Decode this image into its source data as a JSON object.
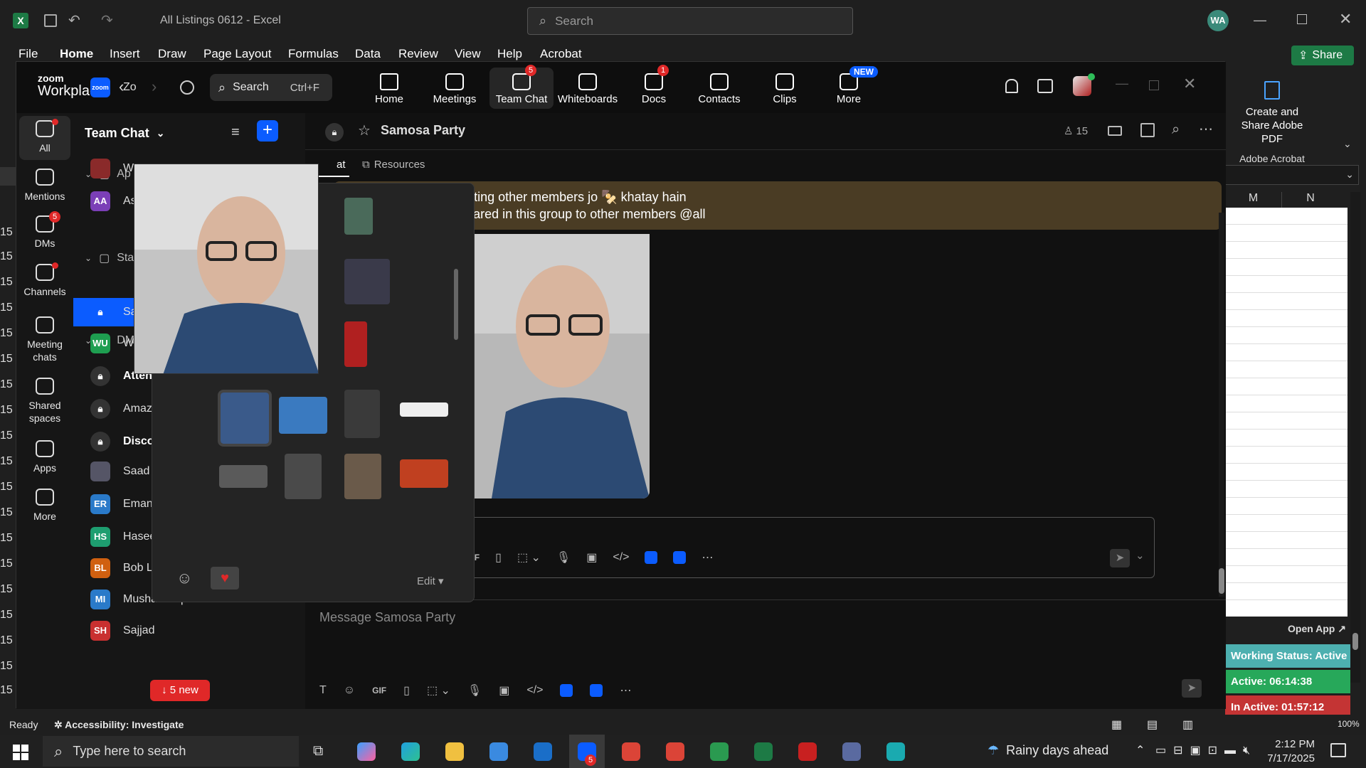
{
  "excel": {
    "title": "All Listings 0612  -  Excel",
    "search_placeholder": "Search",
    "user_initials": "WA",
    "share": "Share",
    "tabs": [
      "File",
      "Home",
      "Insert",
      "Draw",
      "Page Layout",
      "Formulas",
      "Data",
      "Review",
      "View",
      "Help",
      "Acrobat"
    ],
    "adobe_create": "Create and Share Adobe PDF",
    "adobe_group": "Adobe Acrobat",
    "col_m": "M",
    "col_n": "N",
    "row_number": "15",
    "status_ready": "Ready",
    "accessibility": "Accessibility: Investigate",
    "zoom_pct": "100%",
    "open_app": "Open App ↗"
  },
  "zoom": {
    "brand_top": "zoom",
    "brand_bottom": "Workplace",
    "search_label": "Search",
    "search_shortcut": "Ctrl+F",
    "nav": [
      {
        "label": "Home",
        "icon": "home-icon",
        "badge": ""
      },
      {
        "label": "Meetings",
        "icon": "video-icon",
        "badge": ""
      },
      {
        "label": "Team Chat",
        "icon": "chat-icon",
        "badge": "5"
      },
      {
        "label": "Whiteboards",
        "icon": "whiteboard-icon",
        "badge": ""
      },
      {
        "label": "Docs",
        "icon": "docs-icon",
        "badge": "1"
      },
      {
        "label": "Contacts",
        "icon": "contacts-icon",
        "badge": ""
      },
      {
        "label": "Clips",
        "icon": "clips-icon",
        "badge": ""
      },
      {
        "label": "More",
        "icon": "more-icon",
        "badge": "NEW"
      }
    ],
    "rail": [
      {
        "label": "All",
        "icon": "chat-bubble-icon",
        "badge": ""
      },
      {
        "label": "Mentions",
        "icon": "at-icon",
        "badge": ""
      },
      {
        "label": "DMs",
        "icon": "people-icon",
        "badge": "5"
      },
      {
        "label": "Channels",
        "icon": "hash-icon",
        "badge": ""
      },
      {
        "label": "Meeting chats",
        "icon": "calendar-icon",
        "badge": ""
      },
      {
        "label": "Shared spaces",
        "icon": "share-icon",
        "badge": ""
      },
      {
        "label": "Apps",
        "icon": "apps-icon",
        "badge": ""
      },
      {
        "label": "More",
        "icon": "more-dots-icon",
        "badge": ""
      }
    ],
    "chatlist": {
      "title": "Team Chat",
      "sections": [
        {
          "label": "Ap"
        },
        {
          "label": "Sta"
        },
        {
          "label": "DM"
        }
      ],
      "items": [
        {
          "label": "Zo",
          "avatar": "zoom",
          "color": "#0b5cff"
        },
        {
          "label": "W",
          "avatar": "",
          "color": "#8a2a2a"
        },
        {
          "label": "As",
          "avatar": "AA",
          "color": "#7b3fb7"
        },
        {
          "label": "Samosa Party",
          "avatar": "lock",
          "color": "#0b5cff"
        },
        {
          "label": "Waleed Ur Re",
          "avatar": "WU",
          "color": "#1e9e50"
        },
        {
          "label": "Attendance",
          "avatar": "lock",
          "color": "#333"
        },
        {
          "label": "Amazon Sales",
          "avatar": "lock",
          "color": "#333"
        },
        {
          "label": "Discount & S",
          "avatar": "lock",
          "color": "#333"
        },
        {
          "label": "Saad Hassan",
          "avatar": "",
          "color": "#556"
        },
        {
          "label": "Eman Rauf",
          "avatar": "ER",
          "color": "#2a7ac9"
        },
        {
          "label": "Haseeb Shahzad",
          "avatar": "HS",
          "color": "#1e9e70"
        },
        {
          "label": "Bob Lyon",
          "avatar": "BL",
          "color": "#d06010"
        },
        {
          "label": "Musharaf Iqbal",
          "avatar": "MI",
          "color": "#2a7ac9"
        },
        {
          "label": "Sajjad",
          "avatar": "SH",
          "color": "#c93030"
        }
      ],
      "new_pill": "↓ 5 new"
    },
    "chat": {
      "title": "Samosa Party",
      "members": "15",
      "tab_chat": "at",
      "tab_resources": "Resources",
      "banner_line1": "Guys, avoid disrespecting other members jo 🍢 khatay hain",
      "banner_line2": "my picture and vdo shared in this group to other members @all",
      "composer_placeholder": "Message Samosa Party",
      "gif": "GIF"
    },
    "popup": {
      "edit": "Edit ▾"
    }
  },
  "side_panel": {
    "working": "Working Status: Active",
    "active": "Active: 06:14:38",
    "inactive": "In Active: 01:57:12"
  },
  "taskbar": {
    "search": "Type here to search",
    "weather": "Rainy days ahead",
    "time": "2:12 PM",
    "date": "7/17/2025",
    "zoom_badge": "5"
  }
}
